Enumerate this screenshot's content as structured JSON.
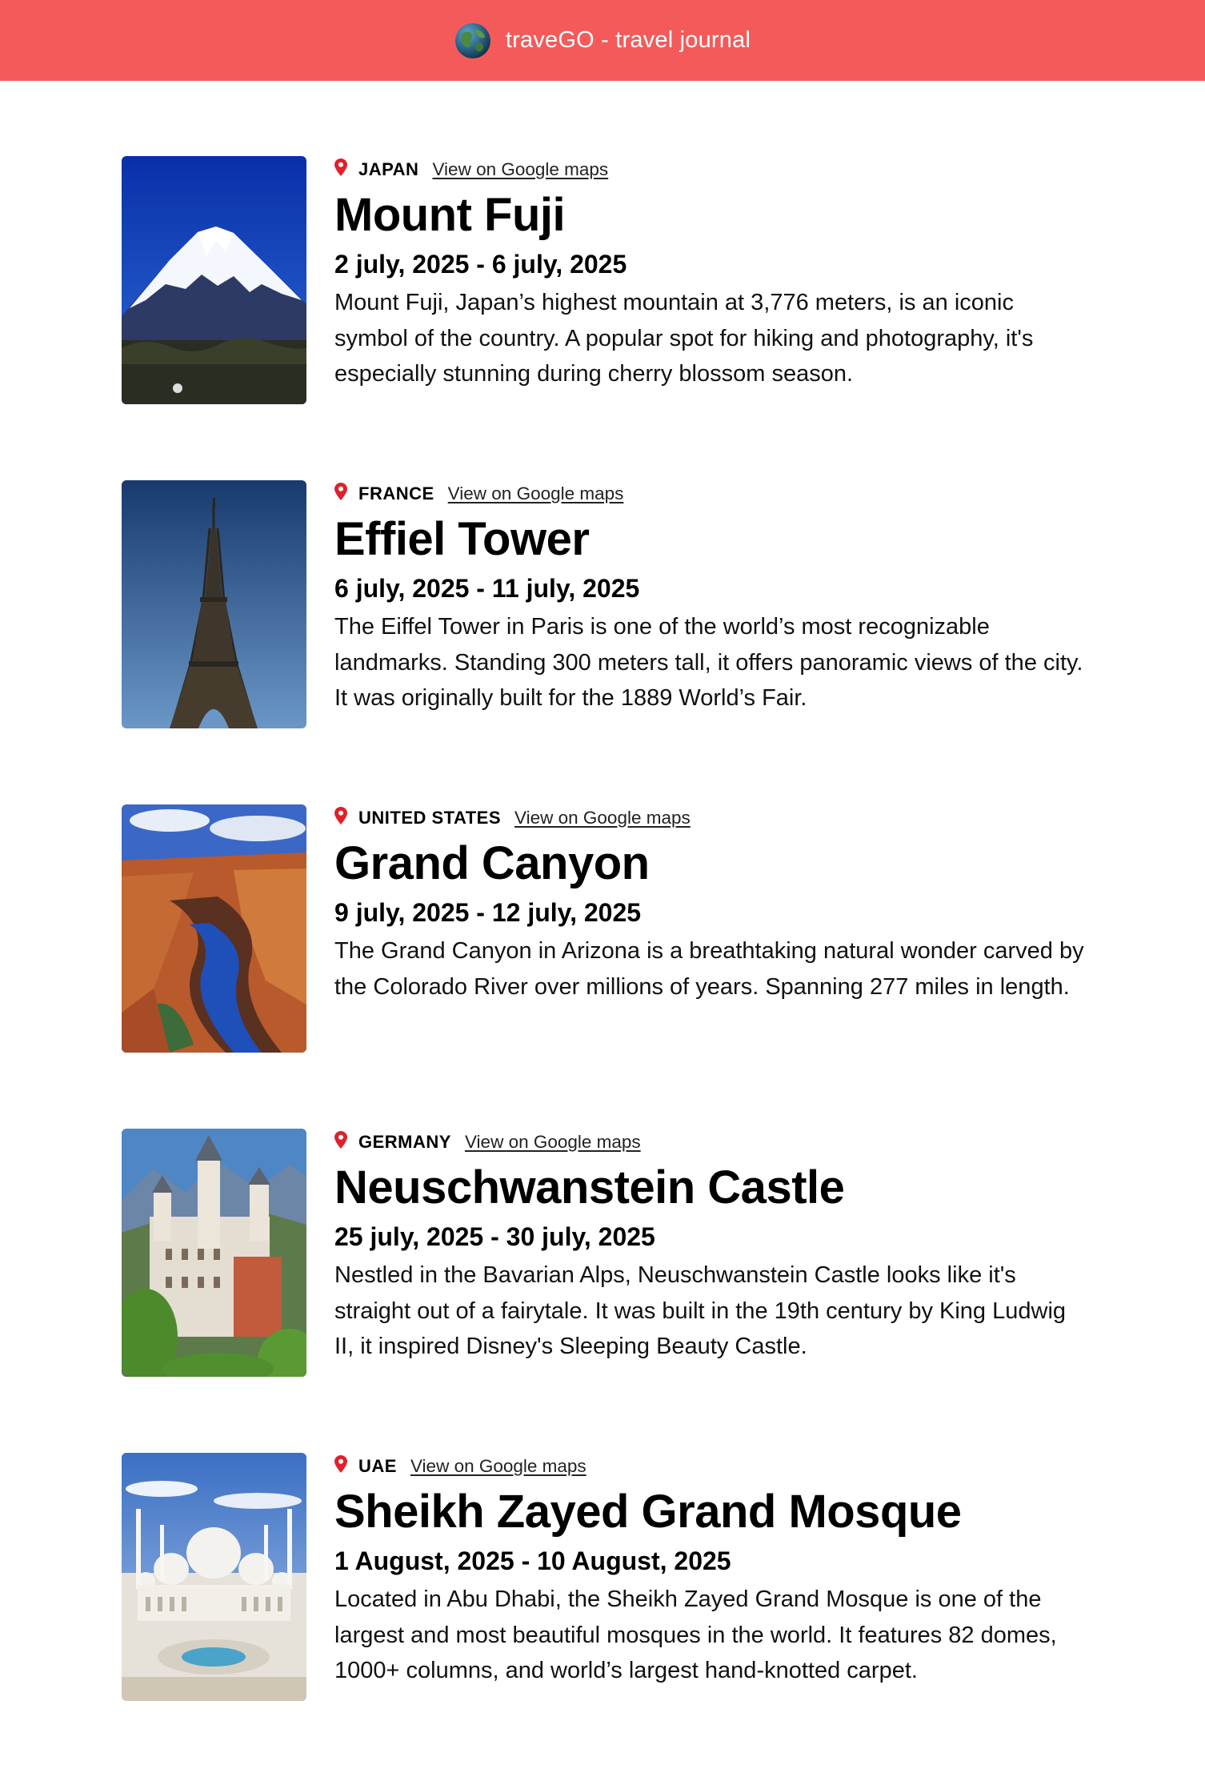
{
  "header": {
    "logo_icon": "globe-icon",
    "brand": "traveGO - travel journal",
    "background": "#f55a5a"
  },
  "entries": [
    {
      "country": "JAPAN",
      "map_link": "View on Google maps",
      "title": "Mount Fuji",
      "dates": "2 july, 2025 - 6 july, 2025",
      "description": "Mount Fuji, Japan’s highest mountain at 3,776 meters, is an iconic symbol of the country. A popular spot for hiking and photography, it's especially stunning during cherry blossom season.",
      "image": "mount-fuji-photo"
    },
    {
      "country": "FRANCE",
      "map_link": "View on Google maps",
      "title": "Effiel Tower",
      "dates": "6 july, 2025 - 11 july, 2025",
      "description": "The Eiffel Tower in Paris is one of the world’s most recognizable landmarks. Standing 300 meters tall, it offers panoramic views of the city. It was originally built for the 1889 World’s Fair.",
      "image": "eiffel-tower-photo"
    },
    {
      "country": "UNITED STATES",
      "map_link": "View on Google maps",
      "title": "Grand Canyon",
      "dates": "9 july, 2025 - 12 july, 2025",
      "description": "The Grand Canyon in Arizona is a breathtaking natural wonder carved by the Colorado River over millions of years. Spanning 277 miles in length.",
      "image": "grand-canyon-photo"
    },
    {
      "country": "GERMANY",
      "map_link": "View on Google maps",
      "title": "Neuschwanstein Castle",
      "dates": "25 july, 2025 - 30 july, 2025",
      "description": "Nestled in the Bavarian Alps, Neuschwanstein Castle looks like it's straight out of a fairytale. It was built in the 19th century by King Ludwig II, it inspired Disney's Sleeping Beauty Castle.",
      "image": "neuschwanstein-castle-photo"
    },
    {
      "country": "UAE",
      "map_link": "View on Google maps",
      "title": "Sheikh Zayed Grand Mosque",
      "dates": "1 August, 2025 - 10 August, 2025",
      "description": "Located in Abu Dhabi, the Sheikh Zayed Grand Mosque is one of the largest and most beautiful mosques in the world. It features 82 domes, 1000+ columns, and world’s largest hand-knotted carpet.",
      "image": "sheikh-zayed-mosque-photo"
    }
  ],
  "pin_icon": "location-pin-icon",
  "pin_color": "#e0202a"
}
